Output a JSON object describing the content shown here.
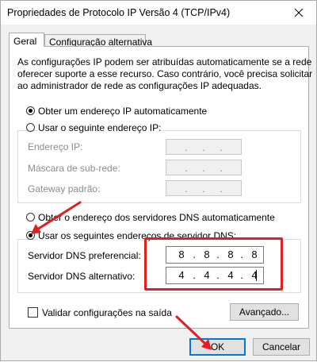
{
  "window": {
    "title": "Propriedades de Protocolo IP Versão 4 (TCP/IPv4)"
  },
  "tabs": [
    {
      "label": "Geral",
      "active": true
    },
    {
      "label": "Configuração alternativa",
      "active": false
    }
  ],
  "description": {
    "line1": "As configurações IP podem ser atribuídas automaticamente se a rede",
    "line2": "oferecer suporte a esse recurso. Caso contrário, você precisa solicitar",
    "line3": "ao administrador de rede as configurações IP adequadas."
  },
  "ip_section": {
    "auto_label": "Obter um endereço IP automaticamente",
    "auto_selected": true,
    "manual_label": "Usar o seguinte endereço IP:",
    "manual_selected": false,
    "fields": [
      {
        "label": "Endereço IP:",
        "octets": [
          "",
          "",
          "",
          ""
        ],
        "separator": "."
      },
      {
        "label": "Máscara de sub-rede:",
        "octets": [
          "",
          "",
          "",
          ""
        ],
        "separator": "."
      },
      {
        "label": "Gateway padrão:",
        "octets": [
          "",
          "",
          "",
          ""
        ],
        "separator": "."
      }
    ]
  },
  "dns_section": {
    "auto_label": "Obter o endereço dos servidores DNS automaticamente",
    "auto_selected": false,
    "manual_label": "Usar os seguintes endereços de servidor DNS:",
    "manual_selected": true,
    "preferred": {
      "label": "Servidor DNS preferencial:",
      "octets": [
        "8",
        "8",
        "8",
        "8"
      ],
      "separator": "."
    },
    "alternate": {
      "label": "Servidor DNS alternativo:",
      "octets": [
        "4",
        "4",
        "4",
        "4"
      ],
      "separator": "."
    }
  },
  "validate": {
    "label": "Validar configurações na saída",
    "checked": false
  },
  "buttons": {
    "advanced": "Avançado...",
    "ok": "OK",
    "cancel": "Cancelar"
  },
  "colors": {
    "highlight": "#e02020",
    "accent": "#0078d7",
    "window_bg": "#f0f0f0",
    "panel_bg": "#ffffff"
  }
}
